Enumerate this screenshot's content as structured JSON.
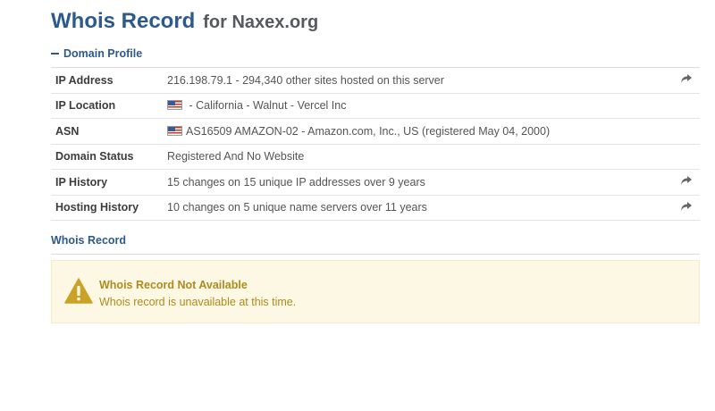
{
  "page": {
    "title_main": "Whois Record",
    "title_sub": "for Naxex.org"
  },
  "domain_profile": {
    "heading": "Domain Profile",
    "rows": [
      {
        "label": "IP Address",
        "value": "216.198.79.1 - 294,340 other sites hosted on this server",
        "flag": false,
        "action": "share-icon"
      },
      {
        "label": "IP Location",
        "value": " - California - Walnut - Vercel Inc",
        "flag": true,
        "action": null
      },
      {
        "label": "ASN",
        "value": "AS16509 AMAZON-02 - Amazon.com, Inc., US (registered May 04, 2000)",
        "flag": true,
        "action": null
      },
      {
        "label": "Domain Status",
        "value": "Registered And No Website",
        "flag": false,
        "action": null
      },
      {
        "label": "IP History",
        "value": "15 changes on 15 unique IP addresses over 9 years",
        "flag": false,
        "action": "share-icon"
      },
      {
        "label": "Hosting History",
        "value": "10 changes on 5 unique name servers over 11 years",
        "flag": false,
        "action": "share-icon"
      }
    ]
  },
  "whois_record": {
    "heading": "Whois Record",
    "alert": {
      "title": "Whois Record Not Available",
      "text": "Whois record is unavailable at this time."
    }
  },
  "colors": {
    "heading": "#2c5a8a",
    "alert_bg": "#fcf8e3",
    "alert_text": "#b08a1e",
    "warn_icon": "#c9a227"
  }
}
